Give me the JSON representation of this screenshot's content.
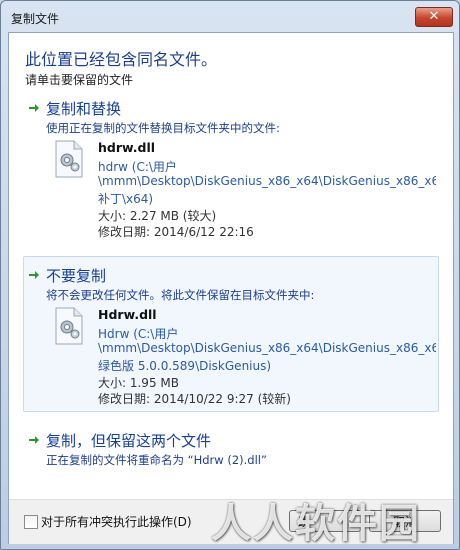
{
  "window": {
    "title": "复制文件",
    "close_glyph": "✕"
  },
  "heading": "此位置已经包含同名文件。",
  "subheading": "请单击要保留的文件",
  "options": [
    {
      "title": "复制和替换",
      "description": "使用正在复制的文件替换目标文件夹中的文件:",
      "file": {
        "name": "hdrw.dll",
        "path_lines": [
          "hdrw (C:\\用户",
          "\\mmm\\Desktop\\DiskGenius_x86_x64\\DiskGenius_x86_x64.ra",
          "补丁\\x64)"
        ],
        "size": "大小: 2.27 MB (较大)",
        "modified": "修改日期: 2014/6/12 22:16"
      }
    },
    {
      "title": "不要复制",
      "description": "将不会更改任何文件。将此文件保留在目标文件夹中:",
      "file": {
        "name": "Hdrw.dll",
        "path_lines": [
          "Hdrw (C:\\用户",
          "\\mmm\\Desktop\\DiskGenius_x86_x64\\DiskGenius_x86_x64.ra",
          "绿色版 5.0.0.589\\DiskGenius)"
        ],
        "size": "大小: 1.95 MB",
        "modified": "修改日期: 2014/10/22 9:27 (较新)"
      }
    },
    {
      "title": "复制，但保留这两个文件",
      "description": "正在复制的文件将重命名为 “Hdrw (2).dll”"
    }
  ],
  "footer": {
    "checkbox_label": "对于所有冲突执行此操作(D)",
    "checkbox_checked": false,
    "skip_label": "跳",
    "cancel_label": "取消"
  },
  "watermark": "人人软件园",
  "colors": {
    "accent": "#1c3f94",
    "arrow": "#2a9a2a",
    "hover_bg": "#f1f7fd"
  },
  "icons": {
    "option_arrow": "green-arrow-icon",
    "file": "dll-gear-file-icon",
    "close": "close-icon"
  }
}
